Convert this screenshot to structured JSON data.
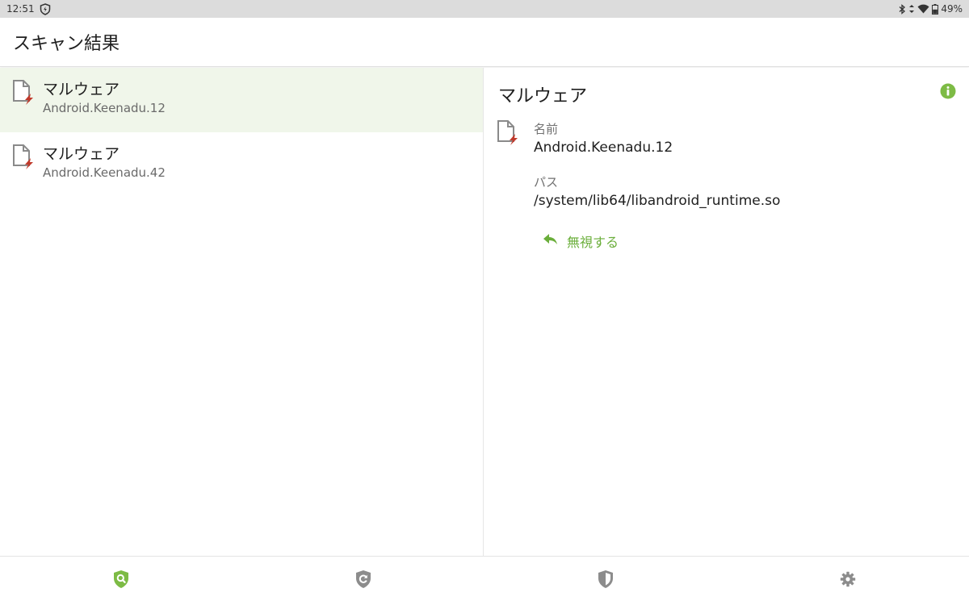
{
  "status_bar": {
    "time": "12:51",
    "battery_percent": "49%",
    "icons": [
      "shield-icon",
      "bluetooth-icon",
      "data-arrows-icon",
      "wifi-icon",
      "battery-icon"
    ]
  },
  "app_bar": {
    "title": "スキャン結果"
  },
  "results": [
    {
      "title": "マルウェア",
      "name": "Android.Keenadu.12",
      "selected": true
    },
    {
      "title": "マルウェア",
      "name": "Android.Keenadu.42",
      "selected": false
    }
  ],
  "detail": {
    "title": "マルウェア",
    "name_label": "名前",
    "name_value": "Android.Keenadu.12",
    "path_label": "パス",
    "path_value": "/system/lib64/libandroid_runtime.so",
    "ignore_label": "無視する"
  },
  "bottom_nav": [
    {
      "icon": "scan-shield-icon",
      "active": true
    },
    {
      "icon": "update-shield-icon",
      "active": false
    },
    {
      "icon": "protection-shield-icon",
      "active": false
    },
    {
      "icon": "settings-gear-icon",
      "active": false
    }
  ],
  "colors": {
    "accent": "#6aae3a",
    "selected_row": "#f0f6ea",
    "threat_red": "#c0392b",
    "inactive_icon": "#8c8c8c"
  }
}
